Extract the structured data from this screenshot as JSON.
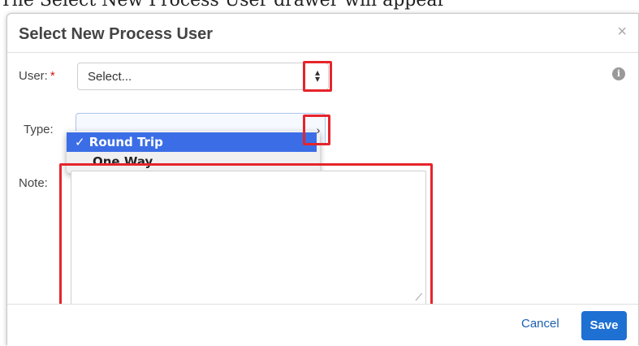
{
  "background_text": "The Select New Process User drawer will appear",
  "dialog": {
    "title": "Select New Process User",
    "close_glyph": "×",
    "info_glyph": "i"
  },
  "user_field": {
    "label": "User:",
    "required_marker": "*",
    "value": "Select..."
  },
  "type_field": {
    "label": "Type:",
    "options": [
      {
        "label": "✓ Round Trip",
        "selected": true
      },
      {
        "label": "One Way",
        "selected": false
      }
    ]
  },
  "note_field": {
    "label": "Note:",
    "value": ""
  },
  "footer": {
    "cancel_label": "Cancel",
    "save_label": "Save"
  },
  "colors": {
    "highlight_red": "#e6242b",
    "save_blue": "#1e70d2",
    "selected_option_blue": "#3b6ee6",
    "link_blue": "#1a5fb4"
  }
}
